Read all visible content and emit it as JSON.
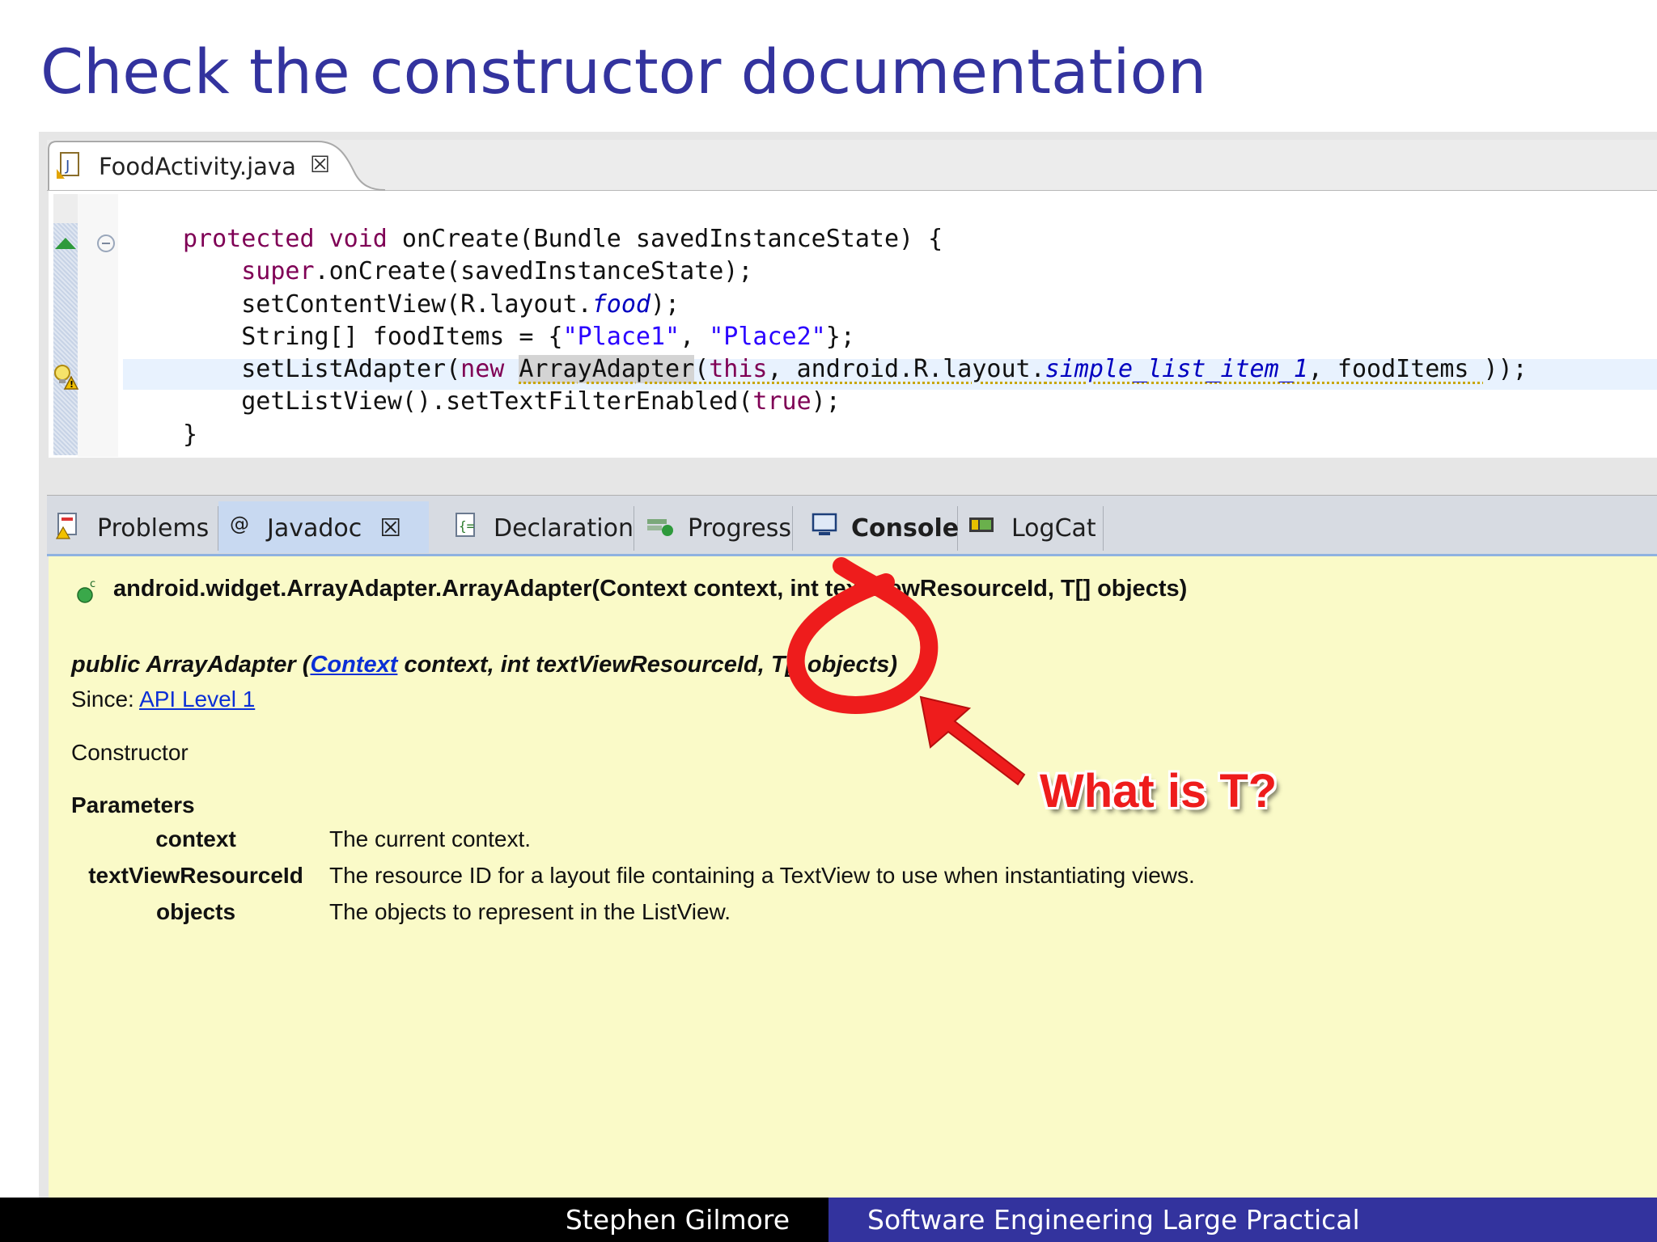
{
  "slide": {
    "title": "Check the constructor documentation"
  },
  "editor": {
    "tab_label": "FoodActivity.java",
    "close_glyph": "☒",
    "lines": [
      {
        "segments": [
          {
            "t": "protected",
            "c": "kw"
          },
          {
            "t": " "
          },
          {
            "t": "void",
            "c": "kw"
          },
          {
            "t": " onCreate(Bundle savedInstanceState) {"
          }
        ]
      },
      {
        "segments": [
          {
            "t": "    "
          },
          {
            "t": "super",
            "c": "kw"
          },
          {
            "t": ".onCreate(savedInstanceState);"
          }
        ]
      },
      {
        "segments": [
          {
            "t": "    setContentView(R.layout."
          },
          {
            "t": "food",
            "c": "field"
          },
          {
            "t": ");"
          }
        ]
      },
      {
        "segments": [
          {
            "t": "    String[] foodItems = {"
          },
          {
            "t": "\"Place1\"",
            "c": "str"
          },
          {
            "t": ", "
          },
          {
            "t": "\"Place2\"",
            "c": "str"
          },
          {
            "t": "};"
          }
        ]
      },
      {
        "segments": [
          {
            "t": "    setListAdapter("
          },
          {
            "t": "new",
            "c": "kw"
          },
          {
            "t": " "
          },
          {
            "t": "ArrayAdapter",
            "c": "hlword underl"
          },
          {
            "t": "(",
            "c": "underl"
          },
          {
            "t": "this",
            "c": "kw underl"
          },
          {
            "t": ", android.R.layout.",
            "c": "underl"
          },
          {
            "t": "simple_list_item_1",
            "c": "field underl"
          },
          {
            "t": ", foodItems ",
            "c": "underl"
          },
          {
            "t": "));"
          }
        ]
      },
      {
        "segments": [
          {
            "t": "    getListView().setTextFilterEnabled("
          },
          {
            "t": "true",
            "c": "kw"
          },
          {
            "t": ");"
          }
        ]
      },
      {
        "segments": [
          {
            "t": "}"
          }
        ]
      }
    ]
  },
  "views": {
    "tabs": [
      {
        "label": "Problems",
        "icon": "problems-icon"
      },
      {
        "label": "Javadoc",
        "icon": "at-icon",
        "active": true
      },
      {
        "label": "Declaration",
        "icon": "declaration-icon"
      },
      {
        "label": "Progress",
        "icon": "progress-icon"
      },
      {
        "label": "Console",
        "icon": "console-icon"
      },
      {
        "label": "LogCat",
        "icon": "logcat-icon"
      }
    ],
    "active_close_glyph": "☒"
  },
  "javadoc": {
    "signature": "android.widget.ArrayAdapter.ArrayAdapter(Context context, int textViewResourceId, T[] objects)",
    "decl_prefix": "public ArrayAdapter (",
    "decl_link": "Context",
    "decl_suffix": " context, int textViewResourceId, T[] objects)",
    "since_label": "Since: ",
    "since_link": "API Level 1",
    "description": "Constructor",
    "params_heading": "Parameters",
    "params": [
      {
        "name": "context",
        "desc": "The current context."
      },
      {
        "name": "textViewResourceId",
        "desc": "The resource ID for a layout file containing a TextView to use when instantiating views."
      },
      {
        "name": "objects",
        "desc": "The objects to represent in the ListView."
      }
    ]
  },
  "annotation": {
    "text": "What is T?",
    "color": "#ee1c1c"
  },
  "footer": {
    "author": "Stephen Gilmore",
    "course": "Software Engineering Large Practical"
  },
  "colors": {
    "title": "#33339e",
    "footer_right": "#33339e",
    "javadoc_bg": "#fafac8",
    "link": "#0b2fd6"
  }
}
